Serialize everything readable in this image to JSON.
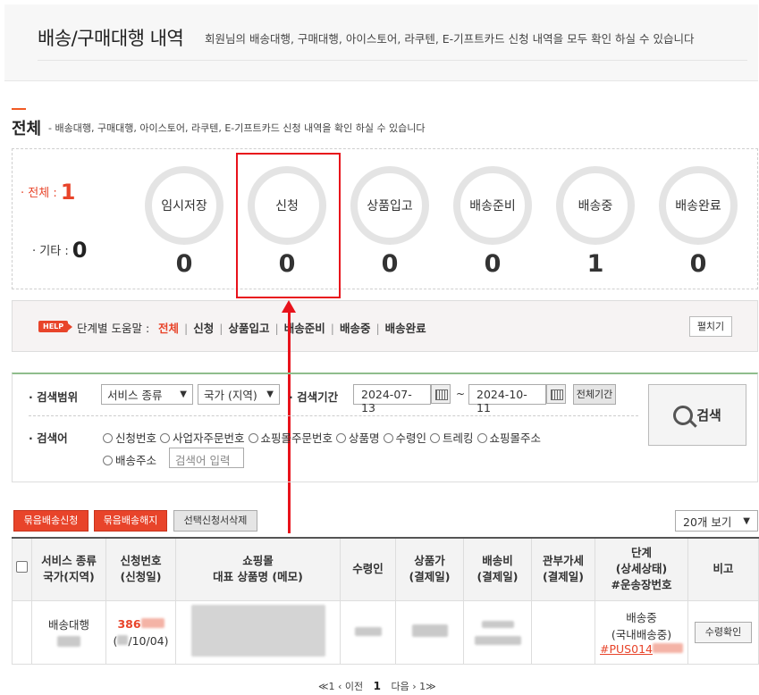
{
  "header": {
    "title": "배송/구매대행 내역",
    "description": "회원님의 배송대행, 구매대행, 아이스토어, 라쿠텐, E-기프트카드 신청 내역을 모두 확인 하실 수 있습니다"
  },
  "section": {
    "title": "전체",
    "description": "- 배송대행, 구매대행, 아이스토어, 라쿠텐, E-기프트카드 신청 내역을 확인 하실 수 있습니다"
  },
  "summary": {
    "total_label": "· 전체 :",
    "total_value": "1",
    "etc_label": "· 기타 :",
    "etc_value": "0",
    "statuses": [
      {
        "label": "임시저장",
        "count": "0"
      },
      {
        "label": "신청",
        "count": "0"
      },
      {
        "label": "상품입고",
        "count": "0"
      },
      {
        "label": "배송준비",
        "count": "0"
      },
      {
        "label": "배송중",
        "count": "1"
      },
      {
        "label": "배송완료",
        "count": "0"
      }
    ]
  },
  "help": {
    "badge": "HELP",
    "label": "단계별 도움말 :",
    "links": [
      "전체",
      "신청",
      "상품입고",
      "배송준비",
      "배송중",
      "배송완료"
    ],
    "expand_label": "펼치기"
  },
  "search": {
    "range_label": "· 검색범위",
    "service_select": "서비스 종류",
    "country_select": "국가 (지역)",
    "period_label": "· 검색기간",
    "date_from": "2024-07-13",
    "date_sep": "~",
    "date_to": "2024-10-11",
    "all_period": "전체기간",
    "keyword_label": "· 검색어",
    "options_row1": [
      "신청번호",
      "사업자주문번호",
      "쇼핑몰주문번호",
      "상품명",
      "수령인",
      "트레킹",
      "쇼핑몰주소"
    ],
    "options_row2": [
      "배송주소"
    ],
    "keyword_placeholder": "검색어 입력",
    "search_button": "검색"
  },
  "actions": {
    "bundle_request": "묶음배송신청",
    "bundle_cancel": "묶음배송해지",
    "delete_selected": "선택신청서삭제",
    "per_page": "20개 보기"
  },
  "table": {
    "headers": [
      "서비스 종류\n국가(지역)",
      "신청번호\n(신청일)",
      "쇼핑몰\n대표 상품명 (메모)",
      "수령인",
      "상품가\n(결제일)",
      "배송비\n(결제일)",
      "관부가세\n(결제일)",
      "단계\n(상세상태)\n#운송장번호",
      "비고"
    ],
    "rows": [
      {
        "service": "배송대행",
        "order_no": "386",
        "order_date": "/10/04)",
        "order_date_prefix": "(",
        "stage": "배송중",
        "stage_detail": "(국내배송중)",
        "tracking": "#PUS014",
        "action": "수령확인"
      }
    ]
  },
  "pager": {
    "first": "≪1",
    "prev": "‹ 이전",
    "current": "1",
    "next": "다음 ›",
    "last": "1≫"
  },
  "colors": {
    "accent": "#e8442a",
    "highlight": "#e8121b"
  }
}
